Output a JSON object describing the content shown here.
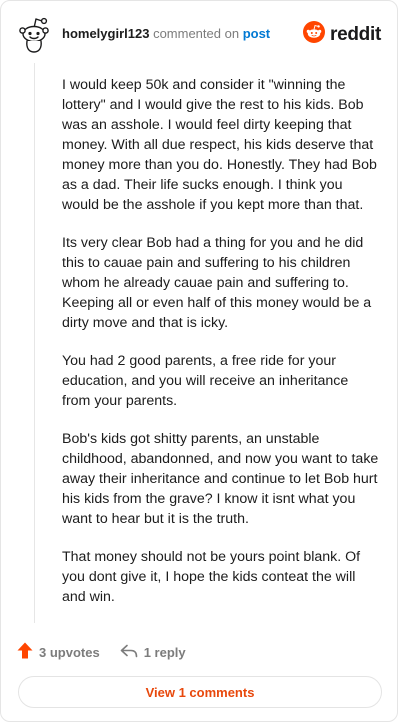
{
  "header": {
    "username": "homelygirl123",
    "action_text": "commented on",
    "link_text": "post",
    "brand": "reddit",
    "avatar_icon": "reddit-snoo-avatar-icon",
    "brand_icon": "reddit-logo-icon",
    "brand_color": "#ff4500"
  },
  "comment": {
    "paragraphs": [
      "I would keep 50k and consider it \"winning the lottery\" and I would give the rest to his kids. Bob was an asshole. I would feel dirty keeping that money. With all due respect, his kids deserve that money more than you do. Honestly. They had Bob as a dad. Their life sucks enough. I think you would be the asshole if you kept more than that.",
      "Its very clear Bob had a thing for you and he did this to cauae pain and suffering to his children whom he already cauae pain and suffering to. Keeping all or even half of this money would be a dirty move and that is icky.",
      "You had 2 good parents, a free ride for your education, and you will receive an inheritance from your parents.",
      "Bob's kids got shitty parents, an unstable childhood, abandonned, and now you want to take away their inheritance and continue to let Bob hurt his kids from the grave? I know it isnt what you want to hear but it is the truth.",
      "That money should not be yours point blank. Of you dont give it, I hope the kids conteat the will and win."
    ]
  },
  "actions": {
    "upvotes": "3 upvotes",
    "replies": "1 reply",
    "upvote_icon": "upvote-arrow-icon",
    "reply_icon": "reply-arrow-icon",
    "upvote_color": "#ff4500"
  },
  "footer": {
    "view_comments": "View 1 comments",
    "accent": "#e8480c"
  }
}
